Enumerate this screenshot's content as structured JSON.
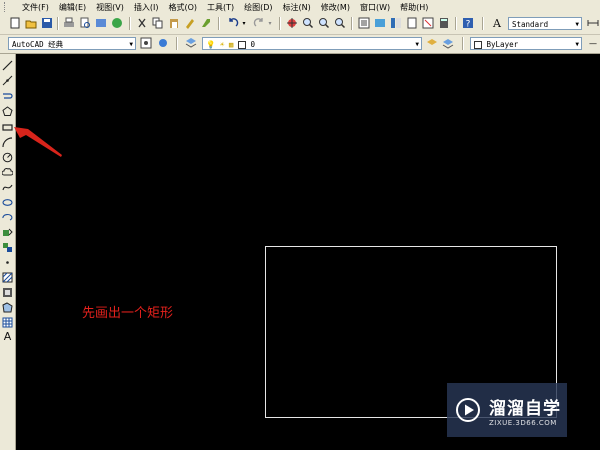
{
  "menubar": {
    "items": [
      {
        "label": "文件(F)"
      },
      {
        "label": "编辑(E)"
      },
      {
        "label": "视图(V)"
      },
      {
        "label": "插入(I)"
      },
      {
        "label": "格式(O)"
      },
      {
        "label": "工具(T)"
      },
      {
        "label": "绘图(D)"
      },
      {
        "label": "标注(N)"
      },
      {
        "label": "修改(M)"
      },
      {
        "label": "窗口(W)"
      },
      {
        "label": "帮助(H)"
      }
    ]
  },
  "toolbar": {
    "text_style": "Standard",
    "workspace": "AutoCAD 经典",
    "layer": "0",
    "color": "ByLayer"
  },
  "canvas": {
    "annotation": "先画出一个矩形"
  },
  "watermark": {
    "title": "溜溜自学",
    "url": "ZIXUE.3D66.COM"
  },
  "colors": {
    "canvas_bg": "#000000",
    "chrome_bg": "#ece9d8",
    "annotation_red": "#e2211c",
    "rect_stroke": "#e6e6e6"
  }
}
